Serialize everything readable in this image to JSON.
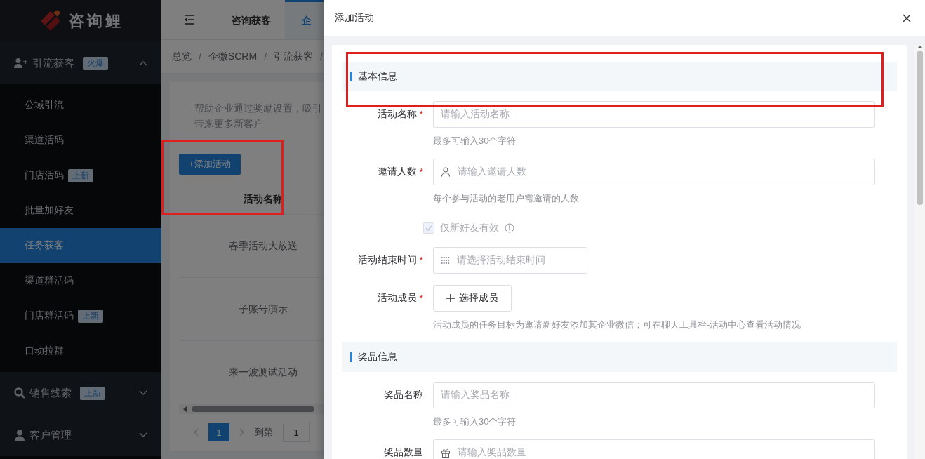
{
  "logo": {
    "text": "咨询鲤"
  },
  "sidebar": {
    "groups": [
      {
        "label": "引流获客",
        "badge": "火爆",
        "expanded": true,
        "children": [
          {
            "label": "公域引流",
            "selected": false
          },
          {
            "label": "渠道活码",
            "selected": false
          },
          {
            "label": "门店活码",
            "badge": "上新",
            "selected": false
          },
          {
            "label": "批量加好友",
            "selected": false
          },
          {
            "label": "任务获客",
            "selected": true
          },
          {
            "label": "渠道群活码",
            "selected": false
          },
          {
            "label": "门店群活码",
            "badge": "上新",
            "selected": false
          },
          {
            "label": "自动拉群",
            "selected": false
          }
        ]
      },
      {
        "label": "销售线索",
        "badge": "上新",
        "expanded": false
      },
      {
        "label": "客户管理",
        "expanded": false
      }
    ]
  },
  "top_tabs": [
    {
      "label": "咨询获客",
      "selected": false
    },
    {
      "label": "企",
      "selected": true
    }
  ],
  "breadcrumb": {
    "separator": "/",
    "items": [
      "总览",
      "企微SCRM",
      "引流获客"
    ]
  },
  "page": {
    "description": [
      "帮助企业通过奖励设置，吸引",
      "带来更多新客户"
    ],
    "add_button": "+添加活动",
    "table": {
      "columns": [
        "活动名称"
      ],
      "rows": [
        [
          "春季活动大放送"
        ],
        [
          "子账号演示"
        ],
        [
          "来一波测试活动"
        ]
      ]
    },
    "pagination": {
      "pages": [
        {
          "label": "1",
          "selected": true
        }
      ],
      "goto_label": "到第",
      "goto_value": "1"
    }
  },
  "drawer": {
    "title": "添加活动",
    "required_mark": "*",
    "sections": [
      {
        "title": "基本信息",
        "fields": [
          {
            "kind": "text",
            "label": "活动名称",
            "required": true,
            "placeholder": "请输入活动名称",
            "hint": "最多可输入30个字符"
          },
          {
            "kind": "invite-count",
            "label": "邀请人数",
            "required": true,
            "placeholder": "请输入邀请人数",
            "hint": "每个参与活动的老用户需邀请的人数"
          },
          {
            "kind": "checkbox",
            "text": "仅新好友有效",
            "checked": true,
            "disabled": true
          },
          {
            "kind": "date",
            "label": "活动结束时间",
            "required": true,
            "placeholder": "请选择活动结束时间"
          },
          {
            "kind": "member-picker",
            "label": "活动成员",
            "required": true,
            "button": "选择成员",
            "hint": "活动成员的任务目标为邀请新好友添加其企业微信；可在聊天工具栏-活动中心查看活动情况"
          }
        ]
      },
      {
        "title": "奖品信息",
        "fields": [
          {
            "kind": "text",
            "label": "奖品名称",
            "required": false,
            "placeholder": "请输入奖品名称",
            "hint": "最多可输入30个字符"
          },
          {
            "kind": "quantity",
            "label": "奖品数量",
            "required": false,
            "placeholder": "请输入奖品数量"
          }
        ]
      }
    ]
  }
}
